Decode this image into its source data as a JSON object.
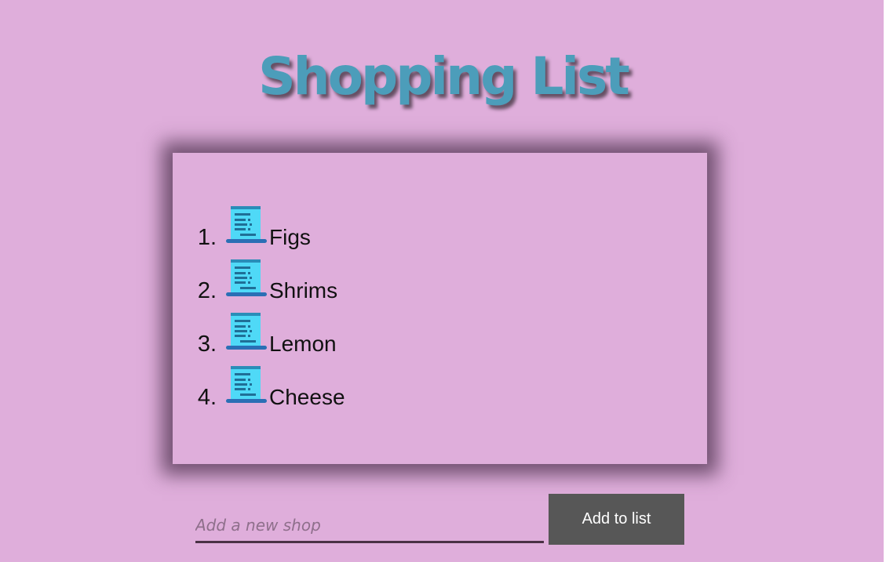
{
  "page": {
    "title": "Shopping List"
  },
  "list": {
    "items": [
      {
        "number": "1.",
        "label": "Figs",
        "icon": "receipt-icon"
      },
      {
        "number": "2.",
        "label": "Shrims",
        "icon": "receipt-icon"
      },
      {
        "number": "3.",
        "label": "Lemon",
        "icon": "receipt-icon"
      },
      {
        "number": "4.",
        "label": "Cheese",
        "icon": "receipt-icon"
      }
    ]
  },
  "form": {
    "input_value": "",
    "input_placeholder": "Add a new shop",
    "add_button_label": "Add to list"
  },
  "colors": {
    "background": "#dfaedb",
    "title": "#4c9dba",
    "button": "#575757",
    "icon": "#4fd9f7"
  }
}
